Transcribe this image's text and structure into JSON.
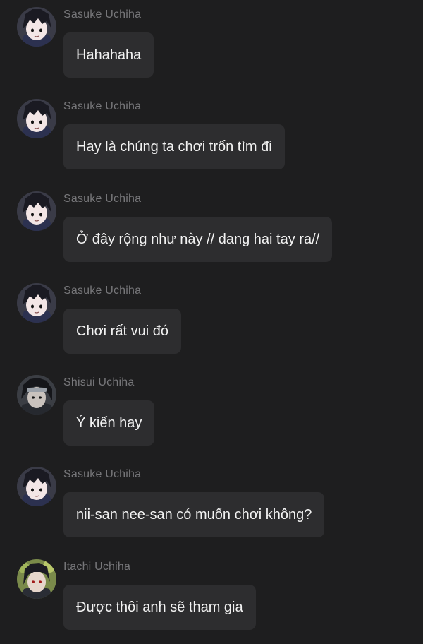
{
  "theme": {
    "background": "#1e1e1f",
    "bubble_color": "#2d2d2f",
    "name_color": "#77777a",
    "text_color": "#f2f2f2"
  },
  "messages": [
    {
      "sender": "Sasuke Uchiha",
      "avatar_icon": "sasuke-avatar-icon",
      "text": "Hahahaha"
    },
    {
      "sender": "Sasuke Uchiha",
      "avatar_icon": "sasuke-avatar-icon",
      "text": "Hay là chúng ta chơi trốn tìm đi"
    },
    {
      "sender": "Sasuke Uchiha",
      "avatar_icon": "sasuke-avatar-icon",
      "text": "Ở đây rộng như này // dang hai tay ra//"
    },
    {
      "sender": "Sasuke Uchiha",
      "avatar_icon": "sasuke-avatar-icon",
      "text": "Chơi rất vui đó"
    },
    {
      "sender": "Shisui Uchiha",
      "avatar_icon": "shisui-avatar-icon",
      "text": "Ý kiến hay"
    },
    {
      "sender": "Sasuke Uchiha",
      "avatar_icon": "sasuke-avatar-icon",
      "text": "nii-san nee-san có muốn chơi không?"
    },
    {
      "sender": "Itachi Uchiha",
      "avatar_icon": "itachi-avatar-icon",
      "text": "Được thôi anh sẽ tham gia"
    }
  ]
}
